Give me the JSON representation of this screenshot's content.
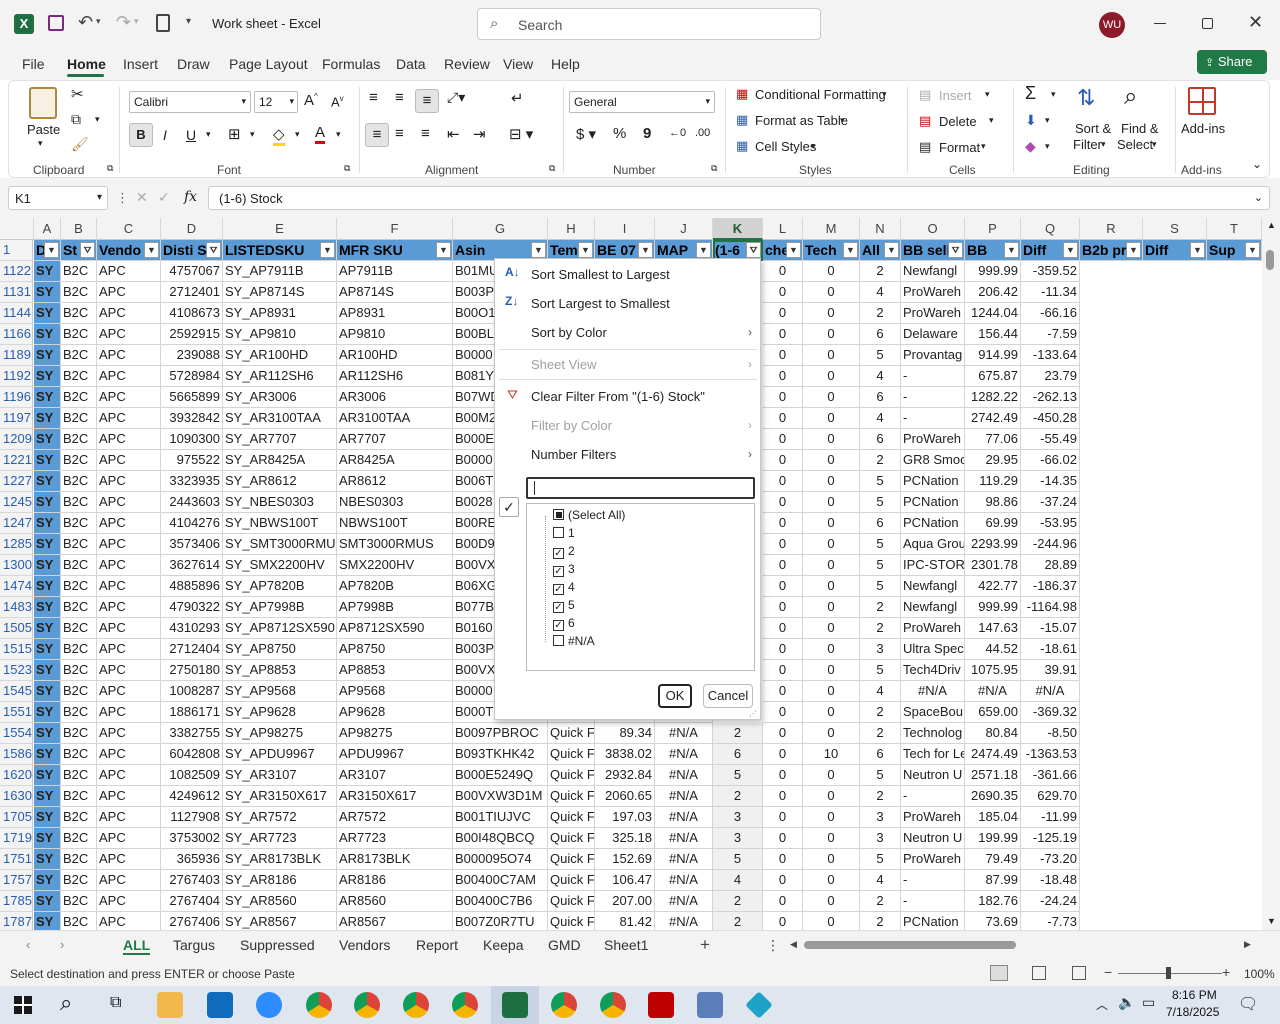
{
  "titlebar": {
    "doc_title": "Work sheet  -  Excel",
    "search_placeholder": "Search",
    "user_initials": "WU"
  },
  "ribbon_tabs": [
    "File",
    "Home",
    "Insert",
    "Draw",
    "Page Layout",
    "Formulas",
    "Data",
    "Review",
    "View",
    "Help"
  ],
  "share_label": "Share",
  "ribbon": {
    "paste": "Paste",
    "clipboard": "Clipboard",
    "font_name": "Calibri",
    "font_size": "12",
    "font_group": "Font",
    "alignment_group": "Alignment",
    "number_format": "General",
    "number_group": "Number",
    "cond_fmt": "Conditional Formatting",
    "fmt_table": "Format as Table",
    "cell_styles": "Cell Styles",
    "styles_group": "Styles",
    "insert": "Insert",
    "delete": "Delete",
    "format": "Format",
    "cells_group": "Cells",
    "sort_filter_1": "Sort &",
    "sort_filter_2": "Filter",
    "find_1": "Find &",
    "find_2": "Select",
    "editing_group": "Editing",
    "addins": "Add-ins",
    "addins_group": "Add-ins"
  },
  "formula_bar": {
    "name_box": "K1",
    "fx": "fx",
    "formula": "(1-6) Stock"
  },
  "columns": [
    "A",
    "B",
    "C",
    "D",
    "E",
    "F",
    "G",
    "H",
    "I",
    "J",
    "K",
    "L",
    "M",
    "N",
    "O",
    "P",
    "Q",
    "R",
    "S",
    "T"
  ],
  "headers": [
    "D",
    "St",
    "Vendo",
    "Disti S",
    "LISTEDSKU",
    "MFR SKU",
    "Asin",
    "Tem",
    "BE 07",
    "MAP",
    "(1-6",
    "che",
    "Tech",
    "All",
    "BB sell",
    "BB",
    "Diff",
    "B2b pr",
    "Diff",
    "Sup"
  ],
  "rows": [
    [
      "1122",
      "SY",
      "B2C",
      "APC",
      "4757067",
      "SY_AP7911B",
      "AP7911B",
      "B01MU",
      "",
      "",
      "",
      "0",
      "0",
      "2",
      "Newfangl",
      "999.99",
      "-359.52"
    ],
    [
      "1131",
      "SY",
      "B2C",
      "APC",
      "2712401",
      "SY_AP8714S",
      "AP8714S",
      "B003P",
      "",
      "",
      "",
      "0",
      "0",
      "4",
      "ProWareh",
      "206.42",
      "-11.34"
    ],
    [
      "1144",
      "SY",
      "B2C",
      "APC",
      "4108673",
      "SY_AP8931",
      "AP8931",
      "B00O1",
      "",
      "",
      "",
      "0",
      "0",
      "2",
      "ProWareh",
      "1244.04",
      "-66.16"
    ],
    [
      "1166",
      "SY",
      "B2C",
      "APC",
      "2592915",
      "SY_AP9810",
      "AP9810",
      "B00BL3",
      "",
      "",
      "",
      "0",
      "0",
      "6",
      "Delaware",
      "156.44",
      "-7.59"
    ],
    [
      "1189",
      "SY",
      "B2C",
      "APC",
      "239088",
      "SY_AR100HD",
      "AR100HD",
      "B0000",
      "",
      "",
      "",
      "0",
      "0",
      "5",
      "Provantag",
      "914.99",
      "-133.64"
    ],
    [
      "1192",
      "SY",
      "B2C",
      "APC",
      "5728984",
      "SY_AR112SH6",
      "AR112SH6",
      "B081Y",
      "",
      "",
      "",
      "0",
      "0",
      "4",
      "-",
      "675.87",
      "23.79"
    ],
    [
      "1196",
      "SY",
      "B2C",
      "APC",
      "5665899",
      "SY_AR3006",
      "AR3006",
      "B07WD",
      "",
      "",
      "",
      "0",
      "0",
      "6",
      "-",
      "1282.22",
      "-262.13"
    ],
    [
      "1197",
      "SY",
      "B2C",
      "APC",
      "3932842",
      "SY_AR3100TAA",
      "AR3100TAA",
      "B00M2",
      "",
      "",
      "",
      "0",
      "0",
      "4",
      "-",
      "2742.49",
      "-450.28"
    ],
    [
      "1209",
      "SY",
      "B2C",
      "APC",
      "1090300",
      "SY_AR7707",
      "AR7707",
      "B000E",
      "",
      "",
      "",
      "0",
      "0",
      "6",
      "ProWareh",
      "77.06",
      "-55.49"
    ],
    [
      "1221",
      "SY",
      "B2C",
      "APC",
      "975522",
      "SY_AR8425A",
      "AR8425A",
      "B0000",
      "",
      "",
      "",
      "0",
      "0",
      "2",
      "GR8 Smoo",
      "29.95",
      "-66.02"
    ],
    [
      "1227",
      "SY",
      "B2C",
      "APC",
      "3323935",
      "SY_AR8612",
      "AR8612",
      "B006T",
      "",
      "",
      "",
      "0",
      "0",
      "5",
      "PCNation",
      "119.29",
      "-14.35"
    ],
    [
      "1245",
      "SY",
      "B2C",
      "APC",
      "2443603",
      "SY_NBES0303",
      "NBES0303",
      "B0028",
      "",
      "",
      "",
      "0",
      "0",
      "5",
      "PCNation",
      "98.86",
      "-37.24"
    ],
    [
      "1247",
      "SY",
      "B2C",
      "APC",
      "4104276",
      "SY_NBWS100T",
      "NBWS100T",
      "B00RE",
      "",
      "",
      "",
      "0",
      "0",
      "6",
      "PCNation",
      "69.99",
      "-53.95"
    ],
    [
      "1285",
      "SY",
      "B2C",
      "APC",
      "3573406",
      "SY_SMT3000RMUS",
      "SMT3000RMUS",
      "B00D9",
      "",
      "",
      "",
      "0",
      "0",
      "5",
      "Aqua Grou",
      "2293.99",
      "-244.96"
    ],
    [
      "1300",
      "SY",
      "B2C",
      "APC",
      "3627614",
      "SY_SMX2200HV",
      "SMX2200HV",
      "B00VX",
      "",
      "",
      "",
      "0",
      "0",
      "5",
      "IPC-STORE",
      "2301.78",
      "28.89"
    ],
    [
      "1474",
      "SY",
      "B2C",
      "APC",
      "4885896",
      "SY_AP7820B",
      "AP7820B",
      "B06XG",
      "",
      "",
      "",
      "0",
      "0",
      "5",
      "Newfangl",
      "422.77",
      "-186.37"
    ],
    [
      "1483",
      "SY",
      "B2C",
      "APC",
      "4790322",
      "SY_AP7998B",
      "AP7998B",
      "B077B",
      "",
      "",
      "",
      "0",
      "0",
      "2",
      "Newfangl",
      "999.99",
      "-1164.98"
    ],
    [
      "1505",
      "SY",
      "B2C",
      "APC",
      "4310293",
      "SY_AP8712SX590",
      "AP8712SX590",
      "B0160",
      "",
      "",
      "",
      "0",
      "0",
      "2",
      "ProWareh",
      "147.63",
      "-15.07"
    ],
    [
      "1515",
      "SY",
      "B2C",
      "APC",
      "2712404",
      "SY_AP8750",
      "AP8750",
      "B003P",
      "",
      "",
      "",
      "0",
      "0",
      "3",
      "Ultra Spec",
      "44.52",
      "-18.61"
    ],
    [
      "1523",
      "SY",
      "B2C",
      "APC",
      "2750180",
      "SY_AP8853",
      "AP8853",
      "B00VX",
      "",
      "",
      "",
      "0",
      "0",
      "5",
      "Tech4Driv",
      "1075.95",
      "39.91"
    ],
    [
      "1545",
      "SY",
      "B2C",
      "APC",
      "1008287",
      "SY_AP9568",
      "AP9568",
      "B0000",
      "",
      "",
      "",
      "0",
      "0",
      "4",
      "#N/A",
      "#N/A",
      "#N/A"
    ],
    [
      "1551",
      "SY",
      "B2C",
      "APC",
      "1886171",
      "SY_AP9628",
      "AP9628",
      "B000T",
      "",
      "",
      "",
      "0",
      "0",
      "2",
      "SpaceBou",
      "659.00",
      "-369.32"
    ],
    [
      "1554",
      "SY",
      "B2C",
      "APC",
      "3382755",
      "SY_AP98275",
      "AP98275",
      "B0097PBROC",
      "Quick F",
      "89.34",
      "#N/A",
      "2",
      "0",
      "0",
      "2",
      "Technolog",
      "80.84",
      "-8.50"
    ],
    [
      "1586",
      "SY",
      "B2C",
      "APC",
      "6042808",
      "SY_APDU9967",
      "APDU9967",
      "B093TKHK42",
      "Quick F",
      "3838.02",
      "#N/A",
      "6",
      "0",
      "10",
      "6",
      "Tech for Le",
      "2474.49",
      "-1363.53"
    ],
    [
      "1620",
      "SY",
      "B2C",
      "APC",
      "1082509",
      "SY_AR3107",
      "AR3107",
      "B000E5249Q",
      "Quick F",
      "2932.84",
      "#N/A",
      "5",
      "0",
      "0",
      "5",
      "Neutron U",
      "2571.18",
      "-361.66"
    ],
    [
      "1630",
      "SY",
      "B2C",
      "APC",
      "4249612",
      "SY_AR3150X617",
      "AR3150X617",
      "B00VXW3D1M",
      "Quick F",
      "2060.65",
      "#N/A",
      "2",
      "0",
      "0",
      "2",
      "-",
      "2690.35",
      "629.70"
    ],
    [
      "1705",
      "SY",
      "B2C",
      "APC",
      "1127908",
      "SY_AR7572",
      "AR7572",
      "B001TIUJVC",
      "Quick F",
      "197.03",
      "#N/A",
      "3",
      "0",
      "0",
      "3",
      "ProWareh",
      "185.04",
      "-11.99"
    ],
    [
      "1719",
      "SY",
      "B2C",
      "APC",
      "3753002",
      "SY_AR7723",
      "AR7723",
      "B00I48QBCQ",
      "Quick F",
      "325.18",
      "#N/A",
      "3",
      "0",
      "0",
      "3",
      "Neutron U",
      "199.99",
      "-125.19"
    ],
    [
      "1751",
      "SY",
      "B2C",
      "APC",
      "365936",
      "SY_AR8173BLK",
      "AR8173BLK",
      "B000095O74",
      "Quick F",
      "152.69",
      "#N/A",
      "5",
      "0",
      "0",
      "5",
      "ProWareh",
      "79.49",
      "-73.20"
    ],
    [
      "1757",
      "SY",
      "B2C",
      "APC",
      "2767403",
      "SY_AR8186",
      "AR8186",
      "B00400C7AM",
      "Quick F",
      "106.47",
      "#N/A",
      "4",
      "0",
      "0",
      "4",
      "-",
      "87.99",
      "-18.48"
    ],
    [
      "1785",
      "SY",
      "B2C",
      "APC",
      "2767404",
      "SY_AR8560",
      "AR8560",
      "B00400C7B6",
      "Quick F",
      "207.00",
      "#N/A",
      "2",
      "0",
      "0",
      "2",
      "-",
      "182.76",
      "-24.24"
    ],
    [
      "1787",
      "SY",
      "B2C",
      "APC",
      "2767406",
      "SY_AR8567",
      "AR8567",
      "B007Z0R7TU",
      "Quick F",
      "81.42",
      "#N/A",
      "2",
      "0",
      "0",
      "2",
      "PCNation",
      "73.69",
      "-7.73"
    ]
  ],
  "filter_menu": {
    "sort_asc": "Sort Smallest to Largest",
    "sort_desc": "Sort Largest to Smallest",
    "sort_color": "Sort by Color",
    "sheet_view": "Sheet View",
    "clear_filter": "Clear Filter From \"(1-6) Stock\"",
    "filter_color": "Filter by Color",
    "number_filters": "Number Filters",
    "search_value": "",
    "options": [
      {
        "label": "(Select All)",
        "state": "mixed"
      },
      {
        "label": "1",
        "state": "unchecked"
      },
      {
        "label": "2",
        "state": "checked"
      },
      {
        "label": "3",
        "state": "checked"
      },
      {
        "label": "4",
        "state": "checked"
      },
      {
        "label": "5",
        "state": "checked"
      },
      {
        "label": "6",
        "state": "checked"
      },
      {
        "label": "#N/A",
        "state": "unchecked"
      }
    ],
    "ok": "OK",
    "cancel": "Cancel"
  },
  "sheet_tabs": [
    "ALL",
    "Targus",
    "Suppressed",
    "Vendors",
    "Report",
    "Keepa",
    "GMD",
    "Sheet1"
  ],
  "status_text": "Select destination and press ENTER or choose Paste",
  "zoom": "100%",
  "clock": {
    "time": "8:16 PM",
    "date": "7/18/2025"
  },
  "colors": {
    "accent": "#217346",
    "header_blue": "#5b9bd5",
    "row_num": "#2a5db0"
  }
}
